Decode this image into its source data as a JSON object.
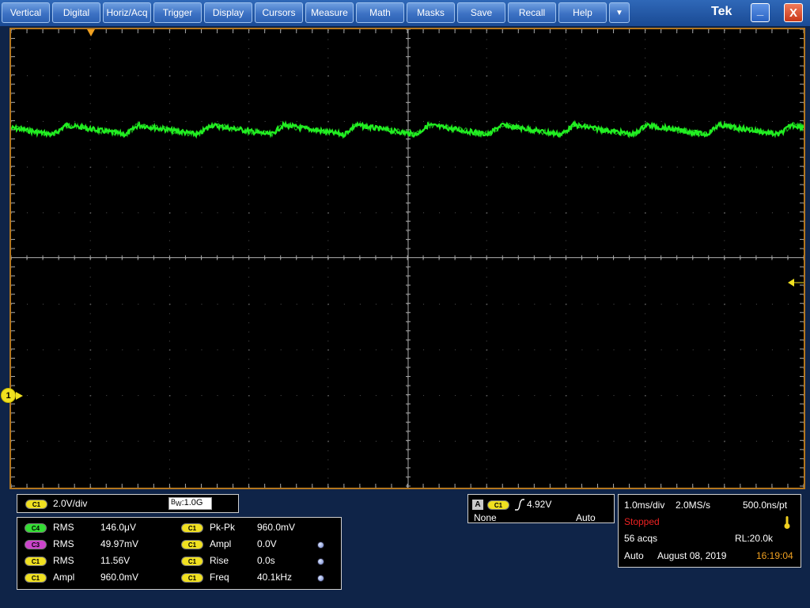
{
  "menu": {
    "items": [
      {
        "label": "Vertical"
      },
      {
        "label": "Digital"
      },
      {
        "label": "Horiz/Acq"
      },
      {
        "label": "Trigger"
      },
      {
        "label": "Display"
      },
      {
        "label": "Cursors"
      },
      {
        "label": "Measure"
      },
      {
        "label": "Math"
      },
      {
        "label": "Masks"
      },
      {
        "label": "Save"
      },
      {
        "label": "Recall"
      },
      {
        "label": "Help"
      }
    ],
    "more_label": "▼",
    "brand": "Tek",
    "minimize_label": "_",
    "close_label": "X"
  },
  "channel1": {
    "ref_label": "1",
    "color": "#f0e020",
    "badge": "C1",
    "scale": "2.0V/div",
    "bw_prefix": "B",
    "bw_sub": "W",
    "bw_value": ":1.0G"
  },
  "waveform": {
    "color": "#22ee22"
  },
  "measurements": {
    "rows": [
      {
        "left": {
          "badge": "C4",
          "badge_color": "#33dd33",
          "name": "RMS",
          "value": "146.0μV"
        },
        "right": {
          "badge": "C1",
          "badge_color": "#f0e020",
          "name": "Pk-Pk",
          "value": "960.0mV"
        },
        "dot": false
      },
      {
        "left": {
          "badge": "C3",
          "badge_color": "#cc44cc",
          "name": "RMS",
          "value": "49.97mV"
        },
        "right": {
          "badge": "C1",
          "badge_color": "#f0e020",
          "name": "Ampl",
          "value": "0.0V"
        },
        "dot": true
      },
      {
        "left": {
          "badge": "C1",
          "badge_color": "#f0e020",
          "name": "RMS",
          "value": "11.56V"
        },
        "right": {
          "badge": "C1",
          "badge_color": "#f0e020",
          "name": "Rise",
          "value": "0.0s"
        },
        "dot": true
      },
      {
        "left": {
          "badge": "C1",
          "badge_color": "#f0e020",
          "name": "Ampl",
          "value": "960.0mV"
        },
        "right": {
          "badge": "C1",
          "badge_color": "#f0e020",
          "name": "Freq",
          "value": "40.1kHz"
        },
        "dot": true
      }
    ]
  },
  "trigger": {
    "letter": "A",
    "source": "C1",
    "level": "4.92V",
    "coupling": "None",
    "mode": "Auto"
  },
  "acquisition": {
    "timebase": "1.0ms/div",
    "sample_rate": "2.0MS/s",
    "resolution": "500.0ns/pt",
    "state": "Stopped",
    "state_color": "#ee2222",
    "acqs": "56 acqs",
    "record_length": "RL:20.0k",
    "mode": "Auto",
    "date": "August 08, 2019",
    "time": "16:19:04",
    "time_color": "#f0a020"
  }
}
